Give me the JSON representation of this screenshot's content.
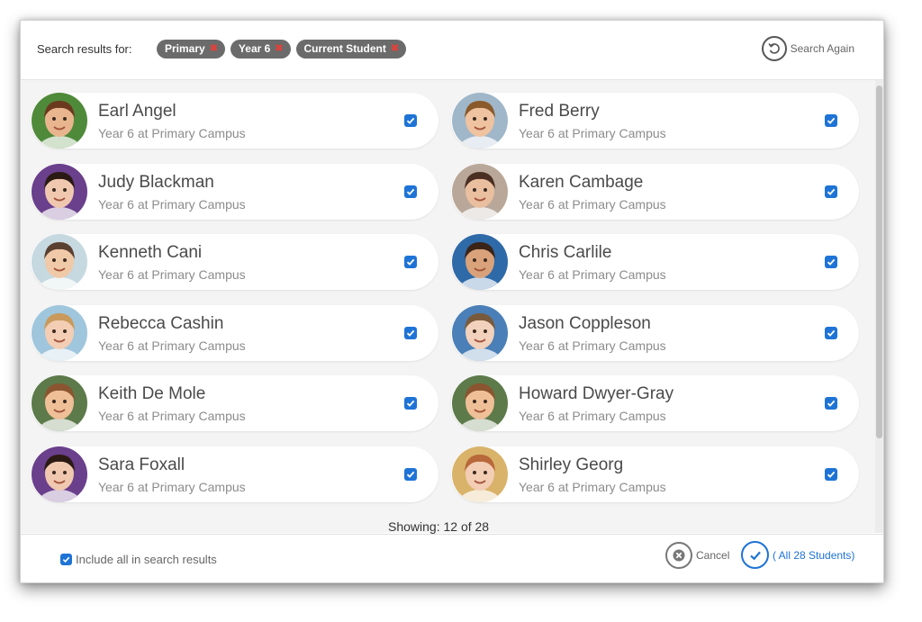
{
  "header": {
    "label": "Search results for:",
    "chips": [
      {
        "label": "Primary"
      },
      {
        "label": "Year 6"
      },
      {
        "label": "Current Student"
      }
    ],
    "search_again": "Search Again"
  },
  "students": [
    {
      "name": "Earl Angel",
      "detail": "Year 6 at Primary Campus",
      "selected": true,
      "skin": "#e9b58f",
      "hair": "#6b3a1e",
      "bg": "#4f8a3a"
    },
    {
      "name": "Fred Berry",
      "detail": "Year 6 at Primary Campus",
      "selected": true,
      "skin": "#efc2a0",
      "hair": "#8a5a2b",
      "bg": "#9fb7c9"
    },
    {
      "name": "Judy Blackman",
      "detail": "Year 6 at Primary Campus",
      "selected": true,
      "skin": "#f0c8b0",
      "hair": "#2b1a14",
      "bg": "#6a3f8c"
    },
    {
      "name": "Karen Cambage",
      "detail": "Year 6 at Primary Campus",
      "selected": true,
      "skin": "#e9bfa0",
      "hair": "#4a2f22",
      "bg": "#b9a89a"
    },
    {
      "name": "Kenneth Cani",
      "detail": "Year 6 at Primary Campus",
      "selected": true,
      "skin": "#f0c9a8",
      "hair": "#5a4030",
      "bg": "#c7d9e0"
    },
    {
      "name": "Chris Carlile",
      "detail": "Year 6 at Primary Campus",
      "selected": true,
      "skin": "#d9a27a",
      "hair": "#3a2418",
      "bg": "#2f6aa8"
    },
    {
      "name": "Rebecca Cashin",
      "detail": "Year 6 at Primary Campus",
      "selected": true,
      "skin": "#f3cdb4",
      "hair": "#c99a5c",
      "bg": "#9fc6dc"
    },
    {
      "name": "Jason Coppleson",
      "detail": "Year 6 at Primary Campus",
      "selected": true,
      "skin": "#f2d2bc",
      "hair": "#7a5a3c",
      "bg": "#4a7fb8"
    },
    {
      "name": "Keith De Mole",
      "detail": "Year 6 at Primary Campus",
      "selected": true,
      "skin": "#efbf98",
      "hair": "#8a5530",
      "bg": "#5d7a4a"
    },
    {
      "name": "Howard Dwyer-Gray",
      "detail": "Year 6 at Primary Campus",
      "selected": true,
      "skin": "#efbf98",
      "hair": "#8a5530",
      "bg": "#5d7a4a"
    },
    {
      "name": "Sara Foxall",
      "detail": "Year 6 at Primary Campus",
      "selected": true,
      "skin": "#f0c8b0",
      "hair": "#2b1a14",
      "bg": "#6a3f8c"
    },
    {
      "name": "Shirley Georg",
      "detail": "Year 6 at Primary Campus",
      "selected": true,
      "skin": "#f3cdb4",
      "hair": "#b8683a",
      "bg": "#d9b36a"
    }
  ],
  "showing": "Showing:  12 of 28",
  "footer": {
    "include_label": "Include all in search results",
    "include_checked": true,
    "cancel_label": "Cancel",
    "confirm_label": "( All 28 Students)"
  },
  "colors": {
    "accent": "#1e73d6",
    "chip": "#6b6b6b",
    "chip_remove": "#e0413a"
  }
}
